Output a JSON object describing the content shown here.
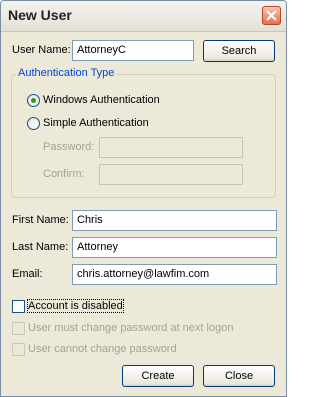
{
  "window": {
    "title": "New User"
  },
  "user_name": {
    "label": "User Name:",
    "value": "AttorneyC",
    "search_label": "Search"
  },
  "auth": {
    "group_title": "Authentication Type",
    "windows_label": "Windows Authentication",
    "simple_label": "Simple Authentication",
    "selected": "windows",
    "password_label": "Password:",
    "confirm_label": "Confirm:",
    "password_value": "",
    "confirm_value": ""
  },
  "first_name": {
    "label": "First Name:",
    "value": "Chris"
  },
  "last_name": {
    "label": "Last Name:",
    "value": "Attorney"
  },
  "email": {
    "label": "Email:",
    "value": "chris.attorney@lawfim.com"
  },
  "options": {
    "disabled_label": "Account is disabled",
    "must_change_label": "User must change password at next logon",
    "cannot_change_label": "User cannot change password",
    "disabled_checked": false,
    "must_change_checked": false,
    "cannot_change_checked": false
  },
  "buttons": {
    "create": "Create",
    "close": "Close"
  },
  "colors": {
    "group_title": "#0046d5",
    "radio_dot": "#21a121",
    "dialog_bg": "#ece9d8"
  }
}
